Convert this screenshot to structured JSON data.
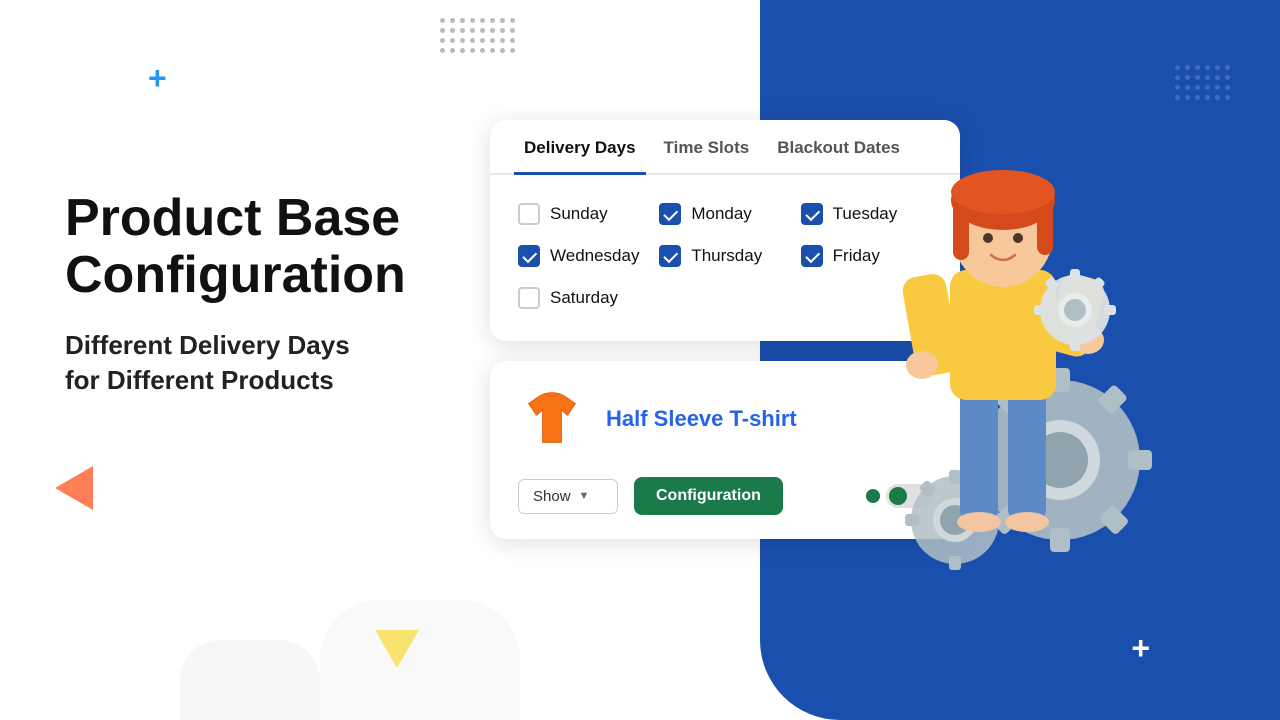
{
  "page": {
    "title": "Product Base Configuration",
    "subtitle_line1": "Different Delivery Days",
    "subtitle_line2": "for Different Products"
  },
  "tabs": [
    {
      "id": "delivery-days",
      "label": "Delivery Days",
      "active": true
    },
    {
      "id": "time-slots",
      "label": "Time Slots",
      "active": false
    },
    {
      "id": "blackout-dates",
      "label": "Blackout Dates",
      "active": false
    }
  ],
  "days": [
    {
      "name": "Sunday",
      "checked": false
    },
    {
      "name": "Monday",
      "checked": true
    },
    {
      "name": "Tuesday",
      "checked": true
    },
    {
      "name": "Wednesday",
      "checked": true
    },
    {
      "name": "Thursday",
      "checked": true
    },
    {
      "name": "Friday",
      "checked": true
    },
    {
      "name": "Saturday",
      "checked": false
    }
  ],
  "product": {
    "name": "Half Sleeve T-shirt",
    "dropdown_label": "Show",
    "config_button": "Configuration",
    "toggle_on": true
  },
  "dots_count": 48,
  "colors": {
    "blue": "#1a4fad",
    "green": "#1a7a4a",
    "orange": "#ff7043",
    "yellow": "#ffd600"
  }
}
